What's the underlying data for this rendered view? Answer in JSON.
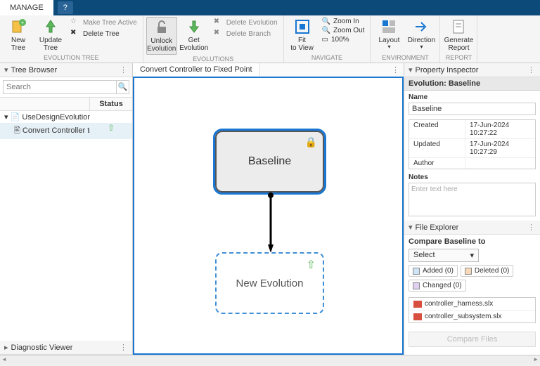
{
  "titlebar": {
    "tab": "MANAGE",
    "help": "?"
  },
  "ribbon": {
    "evolution_tree": {
      "label": "EVOLUTION TREE",
      "new_tree": "New\nTree",
      "update_tree": "Update\nTree",
      "make_active": "Make Tree Active",
      "delete_tree": "Delete Tree"
    },
    "evolutions": {
      "label": "EVOLUTIONS",
      "unlock": "Unlock\nEvolution",
      "get": "Get\nEvolution",
      "delete_evo": "Delete Evolution",
      "delete_branch": "Delete Branch"
    },
    "navigate": {
      "label": "NAVIGATE",
      "fit": "Fit\nto View",
      "zoom_in": "Zoom In",
      "zoom_out": "Zoom Out",
      "hundred": "100%"
    },
    "environment": {
      "label": "ENVIRONMENT",
      "layout": "Layout",
      "direction": "Direction"
    },
    "report": {
      "label": "REPORT",
      "generate": "Generate\nReport"
    }
  },
  "tree_browser": {
    "title": "Tree Browser",
    "search_placeholder": "Search",
    "col_status": "Status",
    "rows": [
      {
        "name": "UseDesignEvolutionMar",
        "indent": 0,
        "icon": "proj"
      },
      {
        "name": "Convert Controller to",
        "indent": 1,
        "icon": "evo",
        "status_up": true,
        "selected": true
      }
    ]
  },
  "canvas": {
    "tab": "Convert Controller to Fixed Point",
    "baseline": "Baseline",
    "new_evo": "New Evolution"
  },
  "inspector": {
    "title": "Property Inspector",
    "sub": "Evolution: Baseline",
    "name_lbl": "Name",
    "name_val": "Baseline",
    "rows": {
      "created_k": "Created",
      "created_v": "17-Jun-2024 10:27:22",
      "updated_k": "Updated",
      "updated_v": "17-Jun-2024 10:27:29",
      "author_k": "Author",
      "author_v": ""
    },
    "notes_lbl": "Notes",
    "notes_ph": "Enter text here"
  },
  "explorer": {
    "title": "File Explorer",
    "compare_lbl": "Compare  Baseline  to",
    "select": "Select",
    "added": "Added (0)",
    "deleted": "Deleted (0)",
    "changed": "Changed (0)",
    "files": [
      "controller_harness.slx",
      "controller_subsystem.slx"
    ],
    "compare_btn": "Compare Files"
  },
  "diag": {
    "title": "Diagnostic Viewer"
  }
}
